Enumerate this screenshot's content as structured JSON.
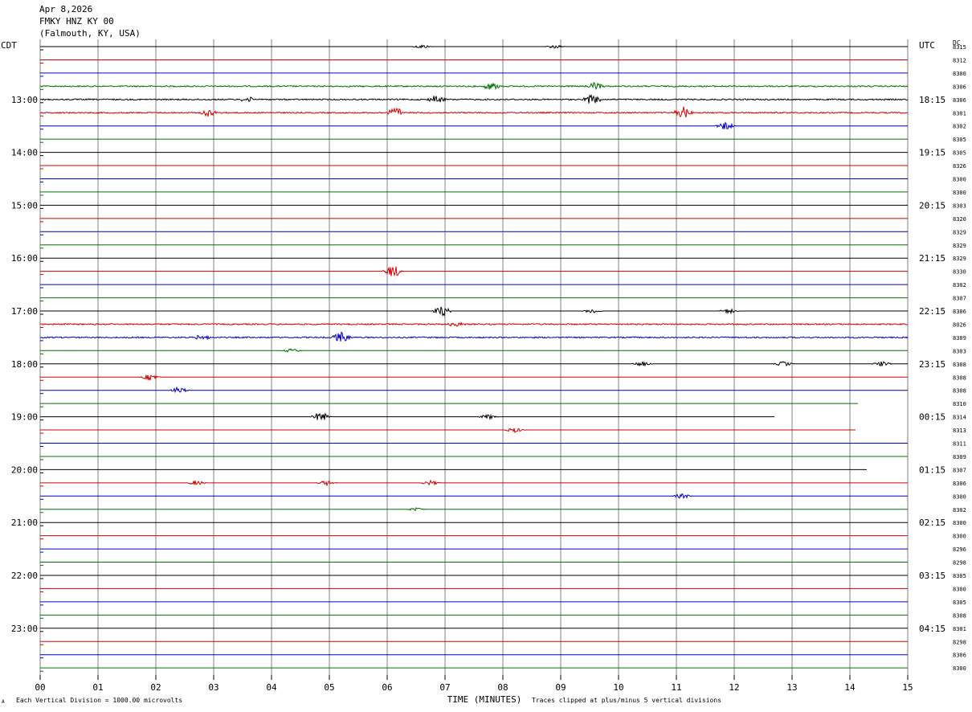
{
  "header": {
    "date": "Apr 8,2026",
    "station": "FMKY HNZ KY 00",
    "location": "(Falmouth, KY, USA)"
  },
  "left_zone": "CDT",
  "right_zone": "UTC",
  "dc_header": "DC",
  "footer": {
    "scale": "Each Vertical Division = 1000.00 microvolts",
    "clip": "Traces clipped at plus/minus 5 vertical divisions",
    "mark": "A"
  },
  "chart_data": {
    "type": "line",
    "title": "",
    "xlabel": "TIME (MINUTES)",
    "ylabel": "",
    "xlim": [
      0,
      15
    ],
    "x_ticks": [
      "00",
      "01",
      "02",
      "03",
      "04",
      "05",
      "06",
      "07",
      "08",
      "09",
      "10",
      "11",
      "12",
      "13",
      "14",
      "15"
    ],
    "trace_colors": [
      "#000000",
      "#d00000",
      "#0000c0",
      "#007000"
    ],
    "trace_count": 48,
    "trace_interval_minutes": 15,
    "grid": true,
    "left_hour_labels": [
      "13:00",
      "14:00",
      "15:00",
      "16:00",
      "17:00",
      "18:00",
      "19:00",
      "20:00",
      "21:00",
      "22:00",
      "23:00"
    ],
    "right_hour_labels": [
      "18:15",
      "19:15",
      "20:15",
      "21:15",
      "22:15",
      "23:15",
      "00:15",
      "01:15",
      "02:15",
      "03:15",
      "04:15"
    ],
    "dc_offsets": [
      "8315",
      "8312",
      "8300",
      "8306",
      "8306",
      "8301",
      "8302",
      "8305",
      "8305",
      "8326",
      "8300",
      "8300",
      "8303",
      "8320",
      "8329",
      "8329",
      "8329",
      "8330",
      "8302",
      "8307",
      "8306",
      "8026",
      "8309",
      "8303",
      "8308",
      "8308",
      "8308",
      "8310",
      "8314",
      "8313",
      "8311",
      "8309",
      "8307",
      "8306",
      "8300",
      "8302",
      "8300",
      "8300",
      "8296",
      "8298",
      "8305",
      "8300",
      "8305",
      "8308",
      "8301",
      "8298",
      "8306",
      "8300"
    ],
    "trace_end_minutes": [
      15,
      15,
      15,
      15,
      15,
      15,
      15,
      15,
      15,
      15,
      15,
      15,
      15,
      15,
      15,
      15,
      15,
      15,
      15,
      15,
      15,
      15,
      15,
      15,
      15,
      15,
      15,
      14.15,
      12.7,
      14.1,
      15,
      15,
      14.3,
      15,
      15,
      15,
      15,
      15,
      15,
      15,
      15,
      15,
      15,
      15,
      15,
      15,
      15,
      15
    ],
    "events": [
      {
        "trace": 0,
        "minute": 6.6,
        "amp": 1.2
      },
      {
        "trace": 0,
        "minute": 8.9,
        "amp": 1.2
      },
      {
        "trace": 3,
        "minute": 7.8,
        "amp": 2.5
      },
      {
        "trace": 3,
        "minute": 9.6,
        "amp": 2
      },
      {
        "trace": 4,
        "minute": 6.85,
        "amp": 3
      },
      {
        "trace": 4,
        "minute": 9.55,
        "amp": 3
      },
      {
        "trace": 4,
        "minute": 3.6,
        "amp": 1.5
      },
      {
        "trace": 5,
        "minute": 2.9,
        "amp": 2
      },
      {
        "trace": 5,
        "minute": 11.1,
        "amp": 4
      },
      {
        "trace": 5,
        "minute": 6.15,
        "amp": 3
      },
      {
        "trace": 6,
        "minute": 11.85,
        "amp": 2.5
      },
      {
        "trace": 17,
        "minute": 6.1,
        "amp": 4
      },
      {
        "trace": 20,
        "minute": 6.95,
        "amp": 3
      },
      {
        "trace": 20,
        "minute": 9.55,
        "amp": 1.5
      },
      {
        "trace": 20,
        "minute": 11.9,
        "amp": 1.5
      },
      {
        "trace": 21,
        "minute": 7.2,
        "amp": 1.5
      },
      {
        "trace": 22,
        "minute": 5.2,
        "amp": 3.5
      },
      {
        "trace": 22,
        "minute": 2.8,
        "amp": 2
      },
      {
        "trace": 23,
        "minute": 4.35,
        "amp": 1.2
      },
      {
        "trace": 24,
        "minute": 10.4,
        "amp": 1.5
      },
      {
        "trace": 24,
        "minute": 12.85,
        "amp": 1.5
      },
      {
        "trace": 24,
        "minute": 14.55,
        "amp": 1.5
      },
      {
        "trace": 25,
        "minute": 1.9,
        "amp": 2
      },
      {
        "trace": 26,
        "minute": 2.4,
        "amp": 2
      },
      {
        "trace": 28,
        "minute": 4.85,
        "amp": 3
      },
      {
        "trace": 28,
        "minute": 7.75,
        "amp": 1.5
      },
      {
        "trace": 29,
        "minute": 8.2,
        "amp": 1.5
      },
      {
        "trace": 33,
        "minute": 2.7,
        "amp": 1.5
      },
      {
        "trace": 33,
        "minute": 4.95,
        "amp": 1.5
      },
      {
        "trace": 33,
        "minute": 6.75,
        "amp": 1.5
      },
      {
        "trace": 34,
        "minute": 11.1,
        "amp": 1.5
      },
      {
        "trace": 35,
        "minute": 6.5,
        "amp": 1
      }
    ],
    "noisy_traces": [
      3,
      4,
      5,
      21,
      22
    ]
  }
}
